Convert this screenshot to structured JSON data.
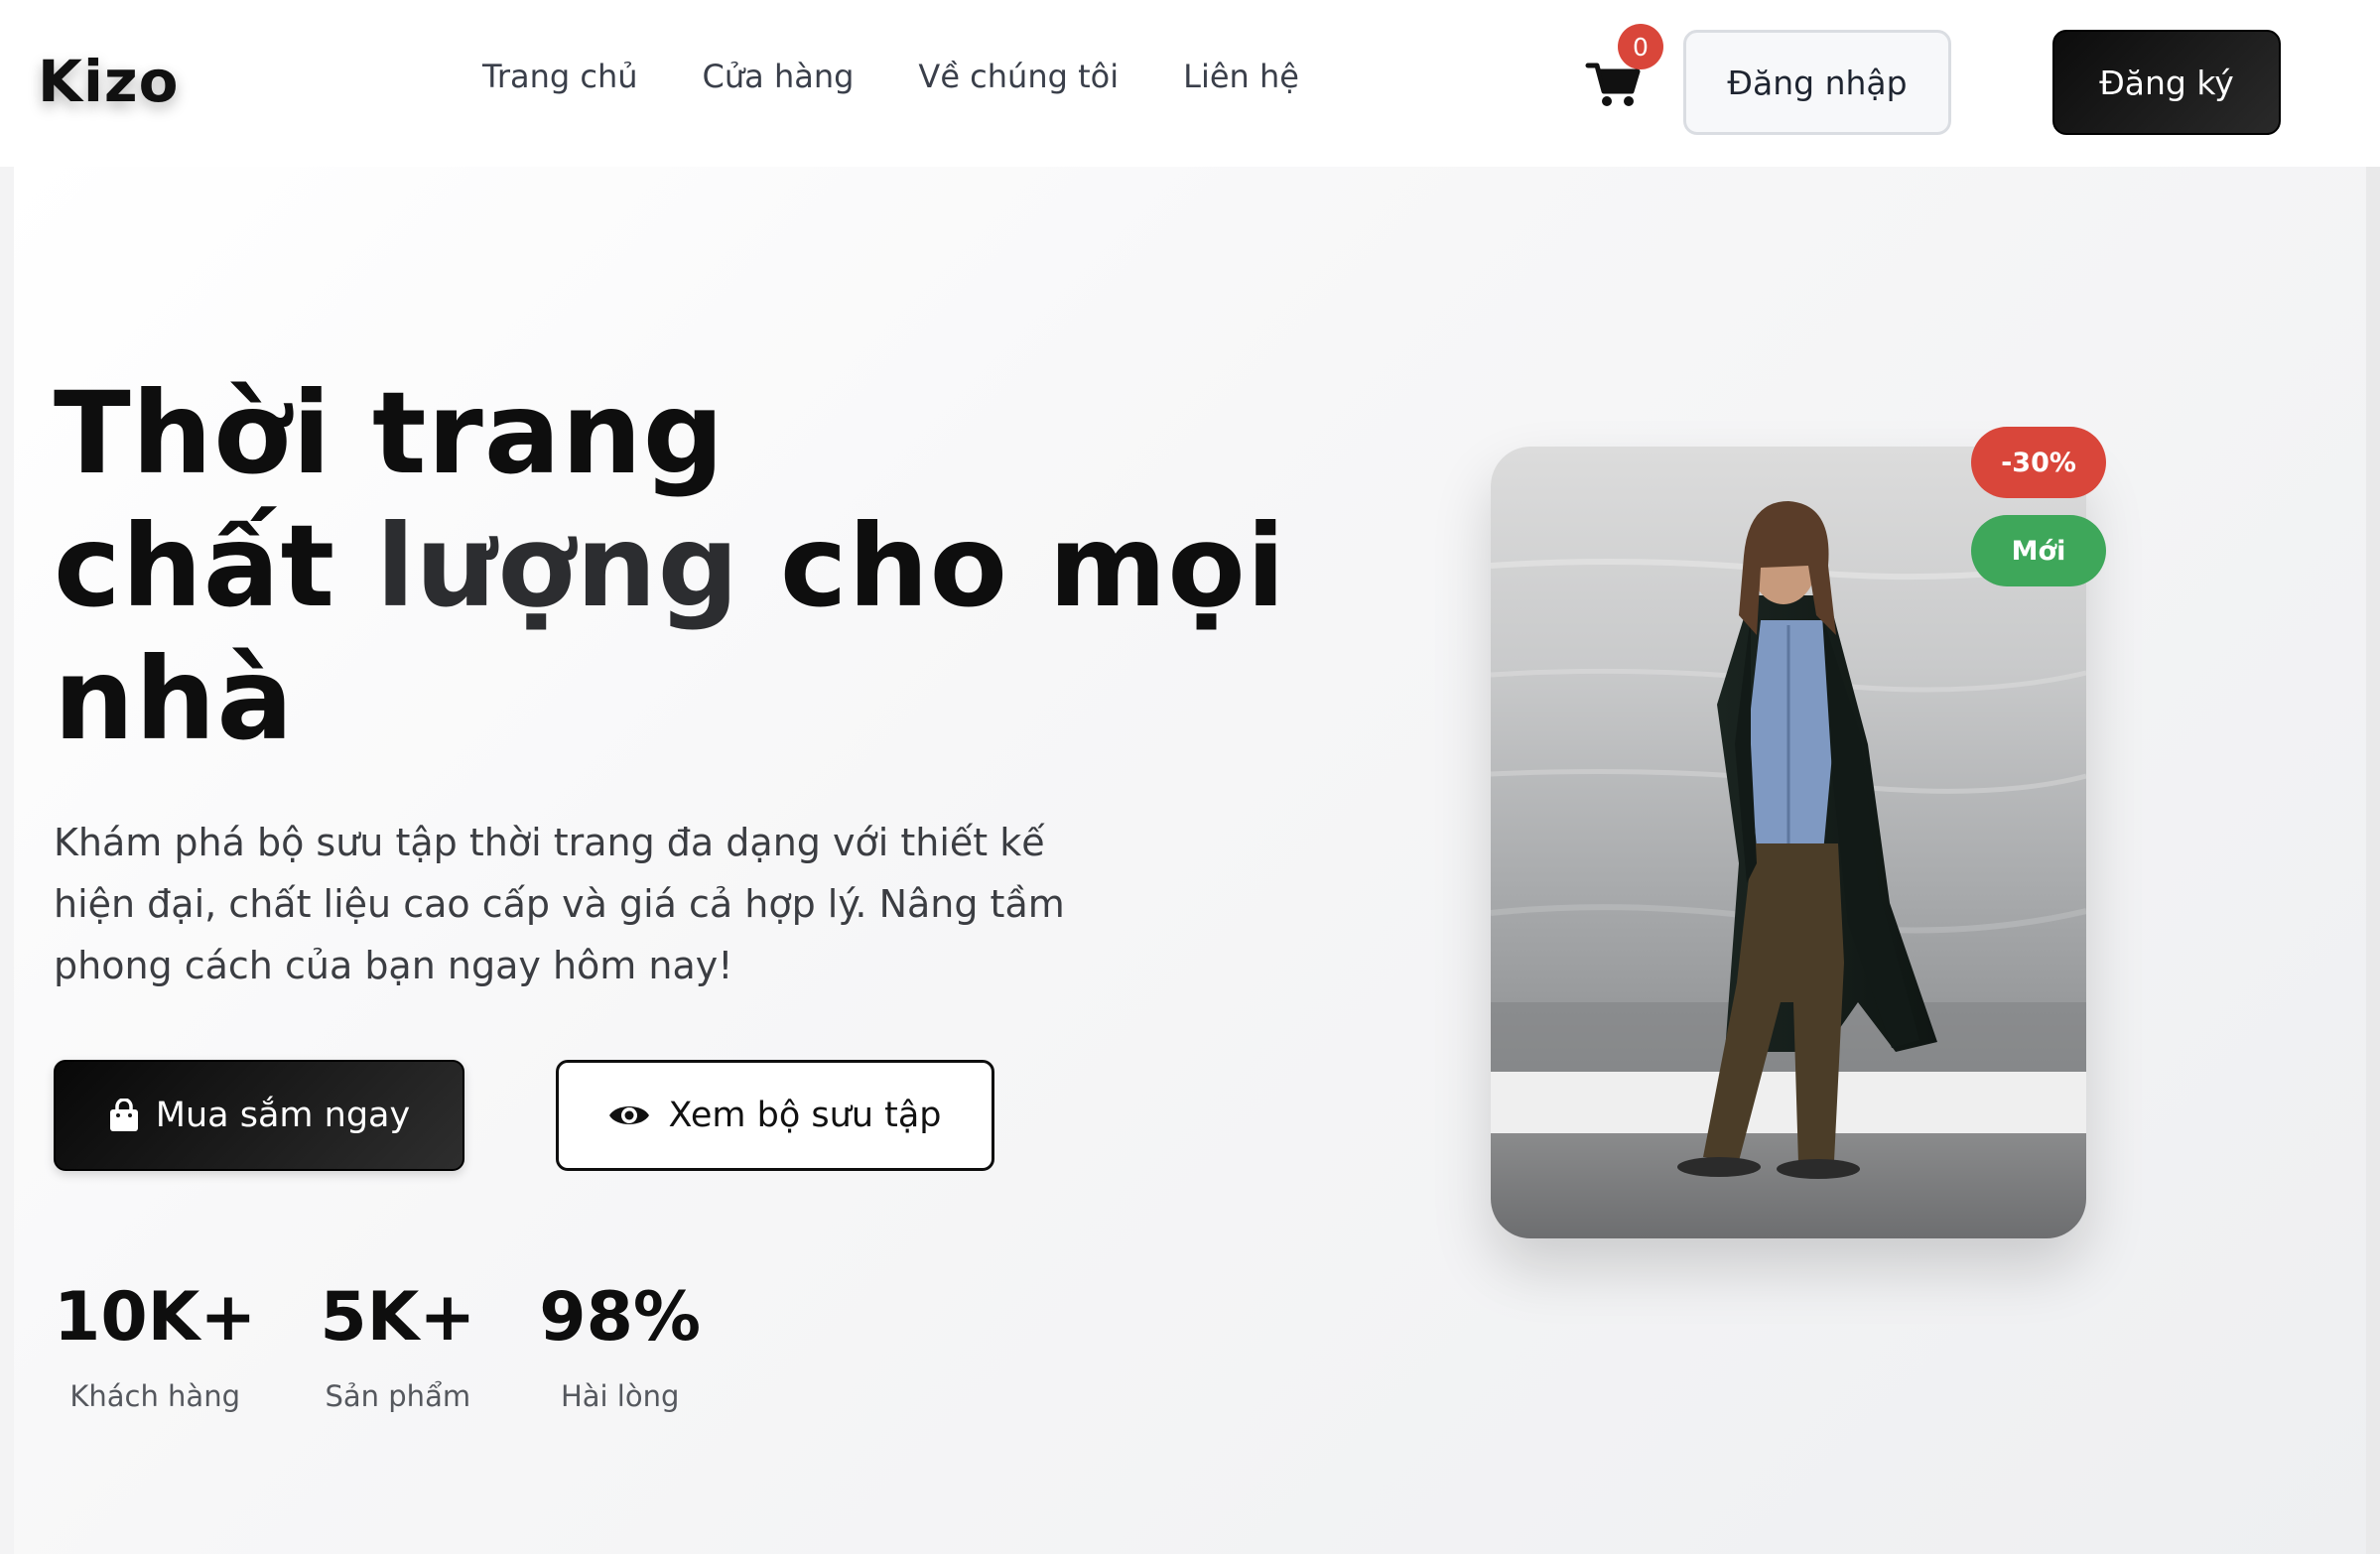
{
  "brand": {
    "logo": "Kizo"
  },
  "nav": {
    "items": [
      {
        "label": "Trang chủ"
      },
      {
        "label": "Cửa hàng"
      },
      {
        "label": "Về chúng tôi"
      },
      {
        "label": "Liên hệ"
      }
    ]
  },
  "cart": {
    "icon": "cart-icon",
    "count": "0"
  },
  "auth": {
    "login_label": "Đăng nhập",
    "signup_label": "Đăng ký"
  },
  "hero": {
    "title_line1": "Thời trang",
    "title_line2a": "chất ",
    "title_line2b": "lượng",
    "title_line2c": " cho mọi",
    "title_line3": "nhà",
    "description": "Khám phá bộ sưu tập thời trang đa dạng với thiết kế hiện đại, chất liệu cao cấp và giá cả hợp lý. Nâng tầm phong cách của bạn ngay hôm nay!",
    "primary_button": {
      "label": "Mua sắm ngay",
      "icon": "shopping-bag-icon"
    },
    "secondary_button": {
      "label": "Xem bộ sưu tập",
      "icon": "eye-icon"
    }
  },
  "stats": [
    {
      "value": "10K+",
      "label": "Khách hàng"
    },
    {
      "value": "5K+",
      "label": "Sản phẩm"
    },
    {
      "value": "98%",
      "label": "Hài lòng"
    }
  ],
  "product": {
    "badges": {
      "sale": "-30%",
      "new": "Mới"
    }
  },
  "colors": {
    "accent_dark": "#0c0c0c",
    "badge_sale": "#d9463a",
    "badge_new": "#3ea75a",
    "cart_badge": "#d9463a"
  }
}
